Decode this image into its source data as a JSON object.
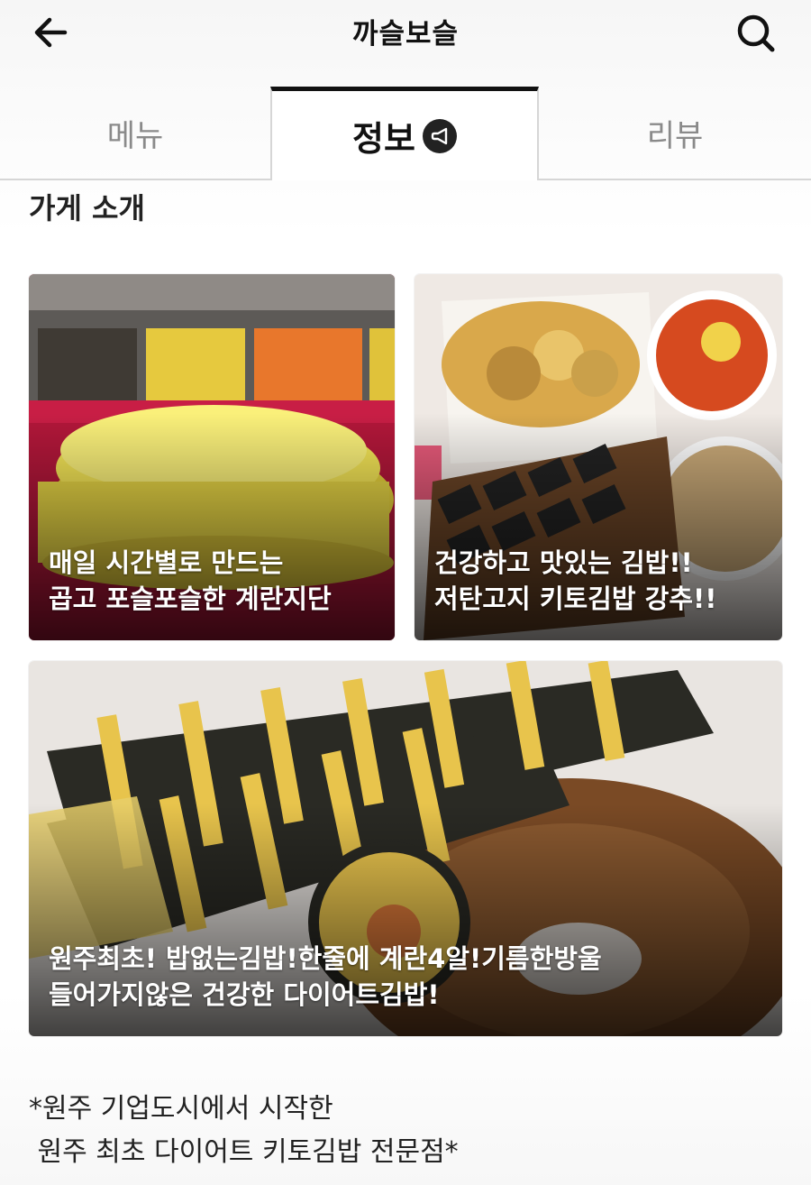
{
  "header": {
    "title": "까슬보슬"
  },
  "tabs": [
    {
      "label": "메뉴",
      "active": false
    },
    {
      "label": "정보",
      "active": true
    },
    {
      "label": "리뷰",
      "active": false
    }
  ],
  "section": {
    "title": "가게 소개"
  },
  "cards": [
    {
      "caption_line1": "매일 시간별로 만드는",
      "caption_line2": "곱고 포슬포슬한 계란지단"
    },
    {
      "caption_line1": "건강하고 맛있는 김밥!!",
      "caption_line2": "저탄고지 키토김밥 강추!!"
    },
    {
      "caption_line1": "원주최초! 밥없는김밥!한줄에 계란4알!기름한방울",
      "caption_line2": "들어가지않은 건강한 다이어트김밥!"
    }
  ],
  "intro": {
    "line1": "*원주 기업도시에서 시작한",
    "line2": " 원주 최초 다이어트 키토김밥 전문점*"
  },
  "icons": {
    "back": "arrow-left-icon",
    "search": "search-icon",
    "notice": "megaphone-icon"
  },
  "colors": {
    "active_tab_border": "#111111",
    "inactive_tab_text": "#8a8a8a",
    "caption_text": "#ffffff"
  }
}
